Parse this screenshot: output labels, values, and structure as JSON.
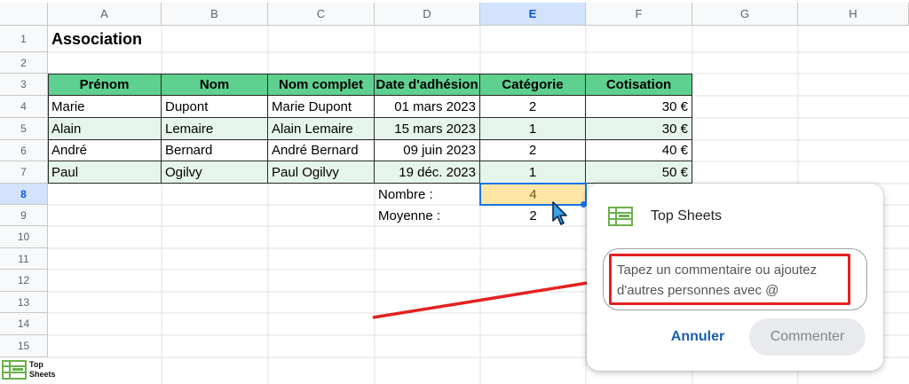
{
  "sheet": {
    "columns": [
      "A",
      "B",
      "C",
      "D",
      "E",
      "F",
      "G",
      "H"
    ],
    "selected_column": "E",
    "rows": [
      "1",
      "2",
      "3",
      "4",
      "5",
      "6",
      "7",
      "8",
      "9",
      "10",
      "11",
      "12",
      "13",
      "14",
      "15"
    ],
    "selected_row": "8",
    "title": "Association",
    "table": {
      "headers": [
        "Prénom",
        "Nom",
        "Nom complet",
        "Date d'adhésion",
        "Catégorie",
        "Cotisation"
      ],
      "rows": [
        [
          "Marie",
          "Dupont",
          "Marie Dupont",
          "01 mars 2023",
          "2",
          "30 €"
        ],
        [
          "Alain",
          "Lemaire",
          "Alain Lemaire",
          "15 mars 2023",
          "1",
          "30 €"
        ],
        [
          "André",
          "Bernard",
          "André Bernard",
          "09 juin 2023",
          "2",
          "40 €"
        ],
        [
          "Paul",
          "Ogilvy",
          "Paul Ogilvy",
          "19 déc. 2023",
          "1",
          "50 €"
        ]
      ]
    },
    "summary": {
      "count_label": "Nombre :",
      "count_value": "4",
      "average_label": "Moyenne :",
      "average_value": "2"
    },
    "colors": {
      "header_green": "#5ed08f",
      "alt_row": "#e6f5ec",
      "active_cell": "#fde6a5",
      "selection_blue": "#1a73e8"
    }
  },
  "comment_popup": {
    "brand": "Top Sheets",
    "placeholder": "Tapez un commentaire ou ajoutez d'autres personnes avec @",
    "cancel_label": "Annuler",
    "submit_label": "Commenter",
    "highlight_color": "#e32222"
  },
  "watermark": {
    "line1": "Top",
    "line2": "Sheets"
  }
}
